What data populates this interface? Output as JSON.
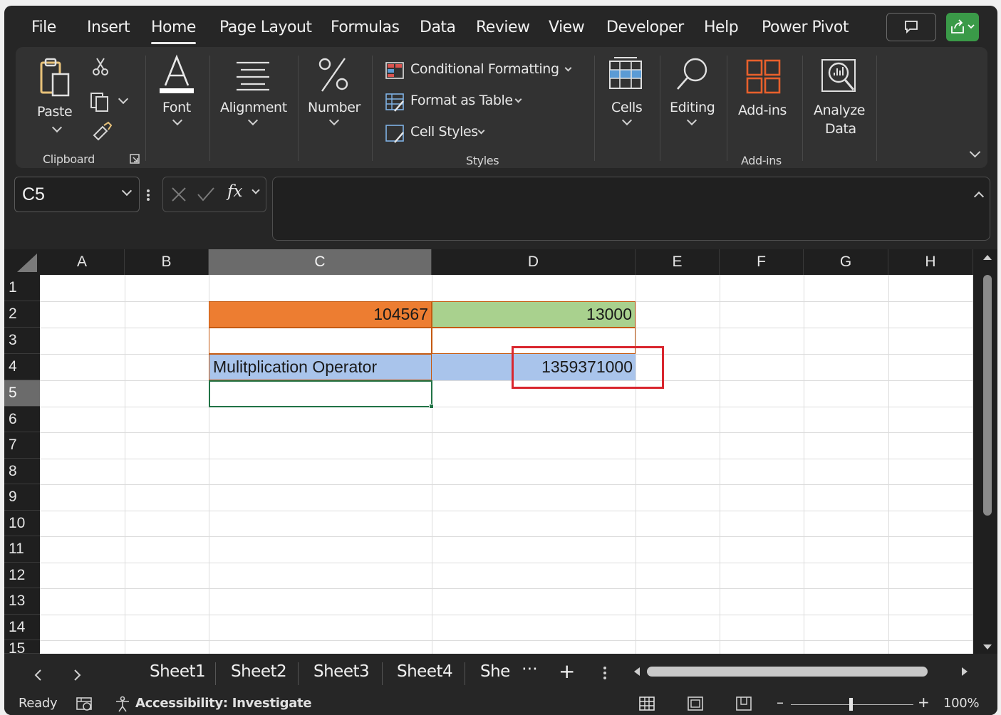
{
  "menu": {
    "tabs": [
      "File",
      "Insert",
      "Home",
      "Page Layout",
      "Formulas",
      "Data",
      "Review",
      "View",
      "Developer",
      "Help",
      "Power Pivot"
    ],
    "active": "Home"
  },
  "ribbon": {
    "clipboard": {
      "paste": "Paste",
      "group": "Clipboard"
    },
    "font": "Font",
    "alignment": "Alignment",
    "number": "Number",
    "styles": {
      "conditional_formatting": "Conditional Formatting",
      "format_as_table": "Format as Table",
      "cell_styles": "Cell Styles",
      "group": "Styles"
    },
    "cells": "Cells",
    "editing": "Editing",
    "addins": {
      "label": "Add-ins",
      "group": "Add-ins"
    },
    "analyze": {
      "line1": "Analyze",
      "line2": "Data"
    }
  },
  "formula": {
    "name_box": "C5",
    "fx": "fx",
    "content": ""
  },
  "grid": {
    "columns": [
      "A",
      "B",
      "C",
      "D",
      "E",
      "F",
      "G",
      "H"
    ],
    "selected_column": "C",
    "rows": [
      "1",
      "2",
      "3",
      "4",
      "5",
      "6",
      "7",
      "8",
      "9",
      "10",
      "11",
      "12",
      "13",
      "14",
      "15"
    ],
    "selected_row": "5",
    "cells": {
      "C2": "104567",
      "D2": "13000",
      "C4": "Mulitplication Operator",
      "D4": "1359371000"
    },
    "colors": {
      "C2_fill": "#ED7D31",
      "D2_fill": "#A9D18E",
      "row4_fill": "#A9C4EB",
      "highlight_box": "#D9262E",
      "selection": "#217346"
    }
  },
  "sheets": {
    "tabs": [
      "Sheet1",
      "Sheet2",
      "Sheet3",
      "Sheet4",
      "She"
    ],
    "more": "⋯",
    "add": "+"
  },
  "status": {
    "ready": "Ready",
    "accessibility": "Accessibility: Investigate",
    "zoom": "100%"
  }
}
